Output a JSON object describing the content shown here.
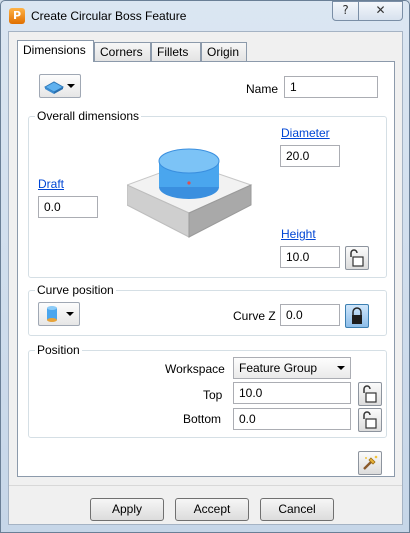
{
  "window": {
    "title": "Create Circular Boss Feature",
    "help_glyph": "?",
    "close_glyph": "✕",
    "app_icon_letter": "P"
  },
  "tabs": [
    {
      "label": "Dimensions",
      "active": true
    },
    {
      "label": "Corners",
      "active": false
    },
    {
      "label": "Fillets",
      "active": false
    },
    {
      "label": "Origin",
      "active": false
    }
  ],
  "name": {
    "label": "Name",
    "value": "1"
  },
  "overall": {
    "title": "Overall dimensions",
    "diameter_label": "Diameter",
    "diameter_value": "20.0",
    "draft_label": "Draft",
    "draft_value": "0.0",
    "height_label": "Height",
    "height_value": "10.0"
  },
  "curve_position": {
    "title": "Curve position",
    "curve_z_label": "Curve Z",
    "curve_z_value": "0.0"
  },
  "position": {
    "title": "Position",
    "workspace_label": "Workspace",
    "workspace_value": "Feature Group",
    "top_label": "Top",
    "top_value": "10.0",
    "bottom_label": "Bottom",
    "bottom_value": "0.0"
  },
  "buttons": {
    "apply": "Apply",
    "accept": "Accept",
    "cancel": "Cancel"
  },
  "colors": {
    "accent_link": "#0046d5",
    "boss_blue": "#3a9be8",
    "lock_locked": "#8cbde9"
  }
}
